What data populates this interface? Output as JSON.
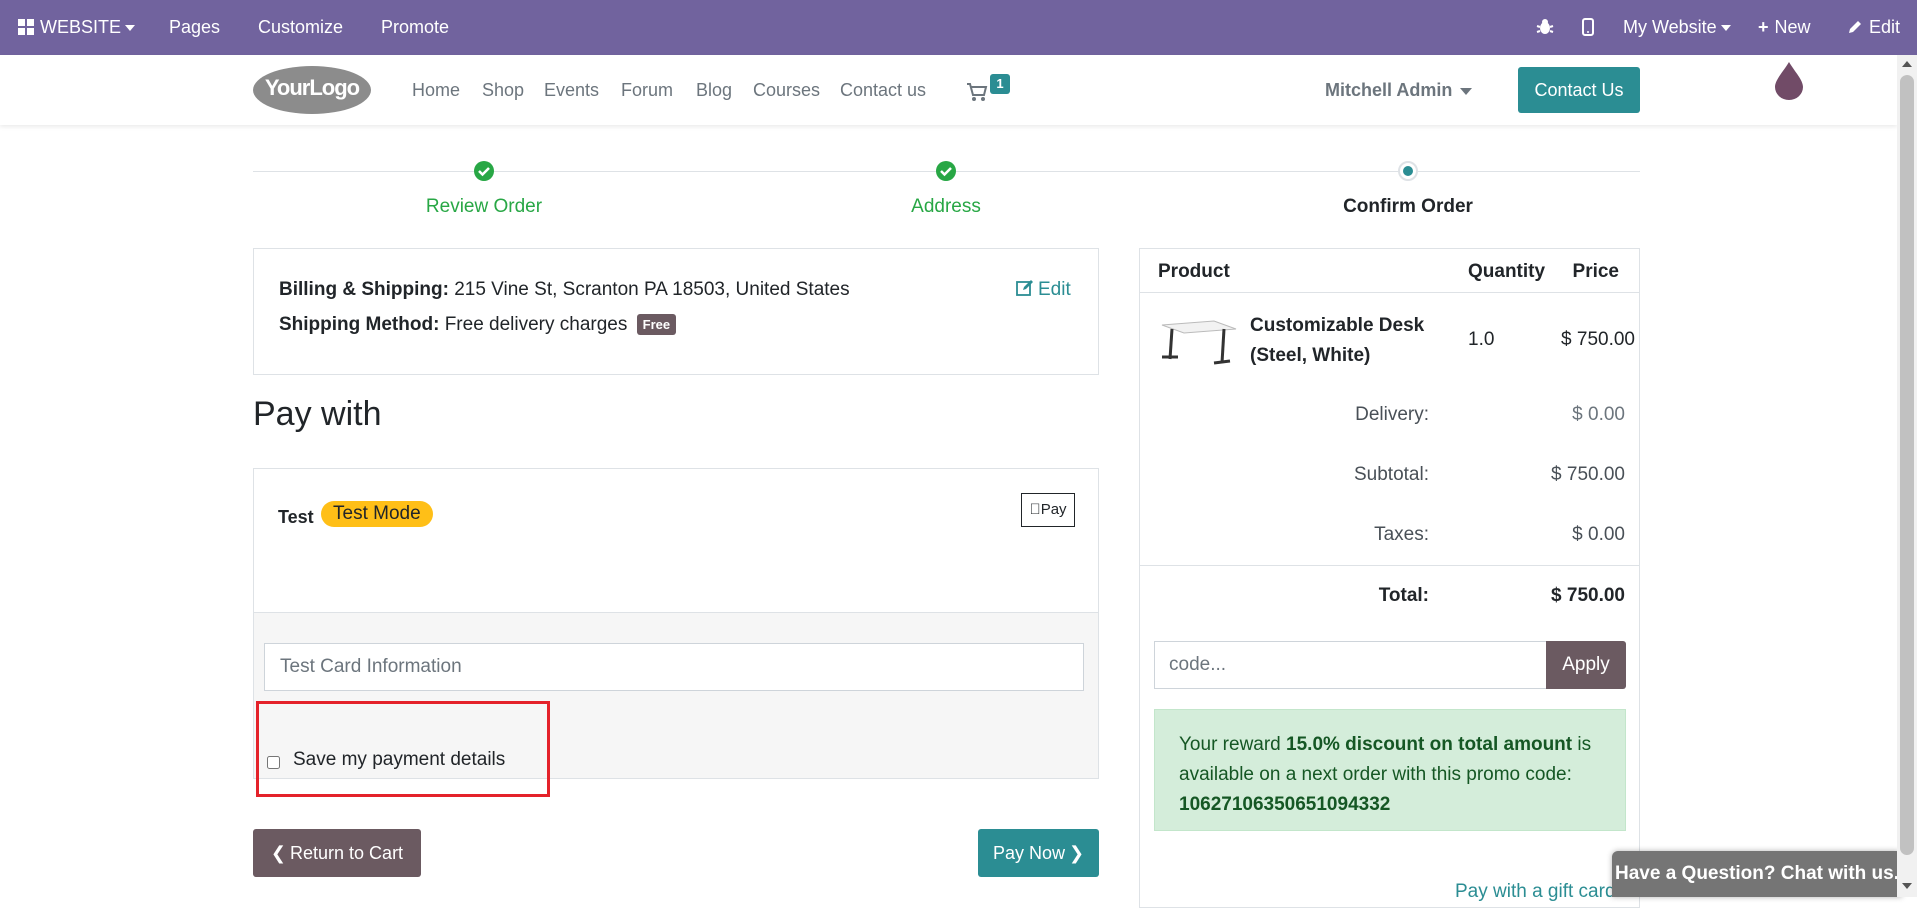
{
  "adminbar": {
    "website_menu": "WEBSITE",
    "pages": "Pages",
    "customize": "Customize",
    "promote": "Promote",
    "my_website": "My Website",
    "new": "New",
    "edit": "Edit"
  },
  "header": {
    "logo_text": "YourLogo",
    "nav": [
      "Home",
      "Shop",
      "Events",
      "Forum",
      "Blog",
      "Courses",
      "Contact us"
    ],
    "cart_count": "1",
    "user": "Mitchell Admin",
    "contact_button": "Contact Us"
  },
  "progress": {
    "steps": [
      {
        "label": "Review Order",
        "state": "done"
      },
      {
        "label": "Address",
        "state": "done"
      },
      {
        "label": "Confirm Order",
        "state": "current"
      }
    ]
  },
  "billing": {
    "billing_label": "Billing & Shipping:",
    "billing_value": "215 Vine St, Scranton PA 18503, United States",
    "shipping_label": "Shipping Method:",
    "shipping_value": "Free delivery charges",
    "shipping_badge": "Free",
    "edit_label": "Edit"
  },
  "payment": {
    "heading": "Pay with",
    "provider": "Test",
    "mode_badge": "Test Mode",
    "apple_pay": "Pay",
    "card_placeholder": "Test Card Information",
    "save_label": "Save my payment details",
    "save_checked": false
  },
  "actions": {
    "return_label": "Return to Cart",
    "pay_label": "Pay Now"
  },
  "summary": {
    "headers": {
      "product": "Product",
      "quantity": "Quantity",
      "price": "Price"
    },
    "items": [
      {
        "name": "Customizable Desk (Steel, White)",
        "quantity": "1.0",
        "price": "$ 750.00"
      }
    ],
    "delivery_label": "Delivery:",
    "delivery_value": "$ 0.00",
    "subtotal_label": "Subtotal:",
    "subtotal_value": "$ 750.00",
    "taxes_label": "Taxes:",
    "taxes_value": "$ 0.00",
    "total_label": "Total:",
    "total_value": "$ 750.00",
    "promo_placeholder": "code...",
    "apply_label": "Apply",
    "reward_prefix": "Your reward ",
    "reward_bold": "15.0% discount on total amount",
    "reward_middle": " is available on a next order with this promo code: ",
    "reward_code": "10627106350651094332",
    "giftcard": "Pay with a gift card"
  },
  "chat": {
    "label": "Have a Question? Chat with us."
  },
  "colors": {
    "admin_bar": "#71639e",
    "primary": "#2b8d93",
    "secondary": "#6b5a61",
    "success": "#28a745",
    "warning": "#ffbf17",
    "highlight": "#e4222a"
  }
}
